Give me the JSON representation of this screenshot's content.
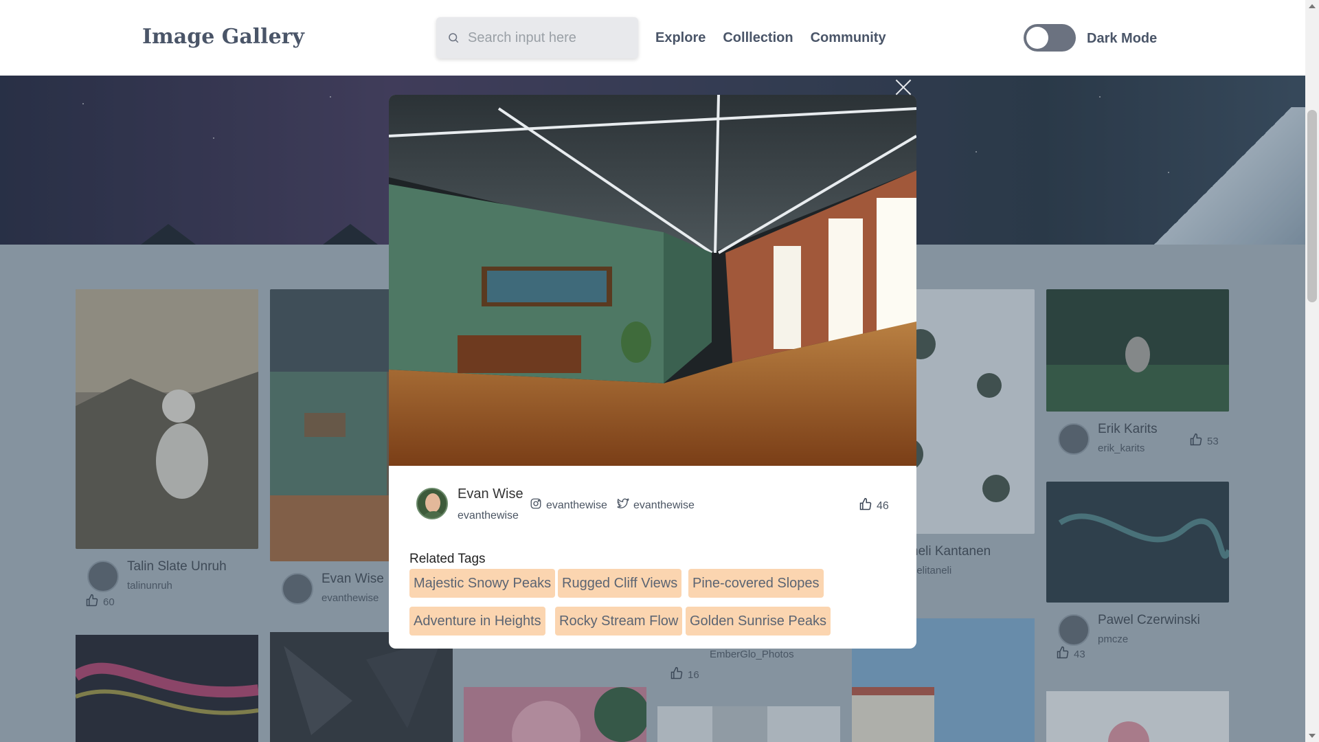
{
  "header": {
    "logo": "Image Gallery",
    "search_placeholder": "Search input here",
    "nav": [
      "Explore",
      "Colllection",
      "Community"
    ],
    "dark_mode_label": "Dark Mode"
  },
  "gallery": [
    {
      "name": "Talin Slate Unruh",
      "handle": "talinunruh",
      "likes": "60"
    },
    {
      "name": "Evan Wise",
      "handle": "evanthewise"
    },
    {
      "name": "neli Kantanen",
      "handle": "nelitaneli"
    },
    {
      "name": "Erik Karits",
      "handle": "erik_karits",
      "likes": "53"
    },
    {
      "name": "Pawel Czerwinski",
      "handle": "pmcze",
      "likes": "43"
    },
    {
      "handle": "EmberGlo_Photos",
      "likes": "16"
    }
  ],
  "modal": {
    "author_name": "Evan Wise",
    "author_handle": "evanthewise",
    "instagram": "evanthewise",
    "twitter": "evanthewise",
    "likes": "46",
    "related_tags_title": "Related Tags",
    "tags": [
      "Majestic Snowy Peaks",
      "Rugged Cliff Views",
      "Pine-covered Slopes",
      "Adventure in Heights",
      "Rocky Stream Flow",
      "Golden Sunrise Peaks"
    ]
  },
  "colors": {
    "tag_bg": "#fbd5b0",
    "toggle_track": "#6b7280"
  }
}
